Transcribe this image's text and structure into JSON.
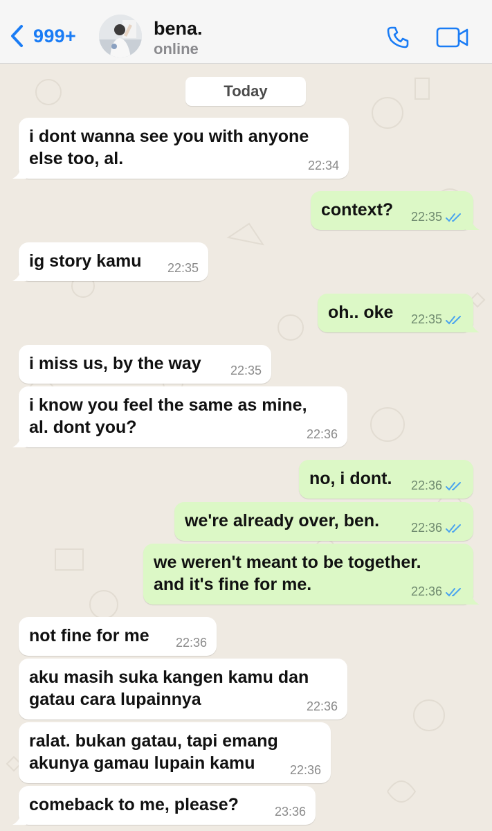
{
  "header": {
    "back_count": "999+",
    "contact_name": "bena.",
    "status": "online"
  },
  "chat": {
    "date_chip": "Today",
    "messages": [
      {
        "dir": "in",
        "lines": [
          "i dont wanna see you with anyone",
          "else too, al."
        ],
        "time": "22:34"
      },
      {
        "dir": "out",
        "lines": [
          "context?"
        ],
        "time": "22:35"
      },
      {
        "dir": "in",
        "lines": [
          "ig story kamu"
        ],
        "time": "22:35"
      },
      {
        "dir": "out",
        "lines": [
          "oh.. oke"
        ],
        "time": "22:35"
      },
      {
        "dir": "in",
        "lines": [
          "i miss us, by the way"
        ],
        "time": "22:35"
      },
      {
        "dir": "in",
        "lines": [
          "i know you feel the same as mine,",
          "al. dont you?"
        ],
        "time": "22:36"
      },
      {
        "dir": "out",
        "lines": [
          "no, i dont."
        ],
        "time": "22:36"
      },
      {
        "dir": "out",
        "lines": [
          "we're already over, ben."
        ],
        "time": "22:36"
      },
      {
        "dir": "out",
        "lines": [
          "we weren't meant to be together.",
          "and it's fine for me."
        ],
        "time": "22:36"
      },
      {
        "dir": "in",
        "lines": [
          "not fine for me"
        ],
        "time": "22:36"
      },
      {
        "dir": "in",
        "lines": [
          "aku masih suka kangen kamu dan",
          "gatau cara lupainnya"
        ],
        "time": "22:36"
      },
      {
        "dir": "in",
        "lines": [
          "ralat. bukan gatau, tapi emang",
          "akunya gamau lupain kamu"
        ],
        "time": "22:36"
      },
      {
        "dir": "in",
        "lines": [
          "comeback to me, please?"
        ],
        "time": "23:36"
      }
    ]
  },
  "colors": {
    "accent": "#1a7cf5",
    "incoming_bubble": "#ffffff",
    "outgoing_bubble": "#dcf8c6",
    "read_ticks": "#4aa3ef",
    "chat_background": "#efeae2"
  },
  "icons": [
    "chevron-left-icon",
    "avatar",
    "phone-icon",
    "video-camera-icon",
    "double-check-icon"
  ]
}
